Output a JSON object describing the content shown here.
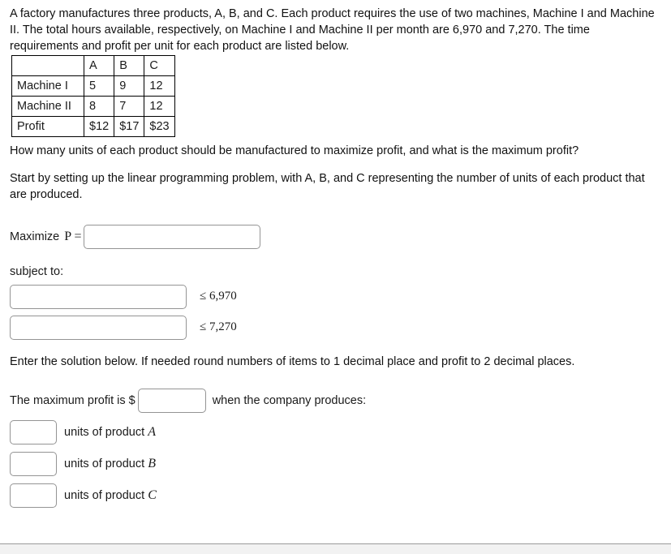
{
  "problem": {
    "intro": "A factory manufactures three products, A, B, and C. Each product requires the use of two machines, Machine I and Machine II. The total hours available, respectively, on Machine I and Machine II per month are 6,970 and 7,270. The time requirements and profit per unit for each product are listed below.",
    "table": {
      "corner": "",
      "columns": [
        "A",
        "B",
        "C"
      ],
      "rows": [
        {
          "label": "Machine I",
          "values": [
            "5",
            "9",
            "12"
          ]
        },
        {
          "label": "Machine II",
          "values": [
            "8",
            "7",
            "12"
          ]
        },
        {
          "label": "Profit",
          "values": [
            "$12",
            "$17",
            "$23"
          ]
        }
      ]
    },
    "question": "How many units of each product should be manufactured to maximize profit, and what is the maximum profit?",
    "setup": "Start by setting up the linear programming problem, with A, B, and C representing the number of units of each product that are produced."
  },
  "objective": {
    "label": "Maximize",
    "symbol": "P =",
    "value": "",
    "placeholder": ""
  },
  "constraints": {
    "label": "subject to:",
    "rows": [
      {
        "value": "",
        "placeholder": "",
        "rhs": "≤ 6,970"
      },
      {
        "value": "",
        "placeholder": "",
        "rhs": "≤ 7,270"
      }
    ]
  },
  "solution": {
    "instructions": "Enter the solution below. If needed round numbers of items to 1 decimal place and profit to 2 decimal places.",
    "profit_prefix": "The maximum profit is",
    "dollar_sign": "$",
    "profit_value": "",
    "profit_suffix": "when the company produces:",
    "units": [
      {
        "value": "",
        "text_before": "units of product",
        "variable": "A"
      },
      {
        "value": "",
        "text_before": "units of product",
        "variable": "B"
      },
      {
        "value": "",
        "text_before": "units of product",
        "variable": "C"
      }
    ]
  }
}
